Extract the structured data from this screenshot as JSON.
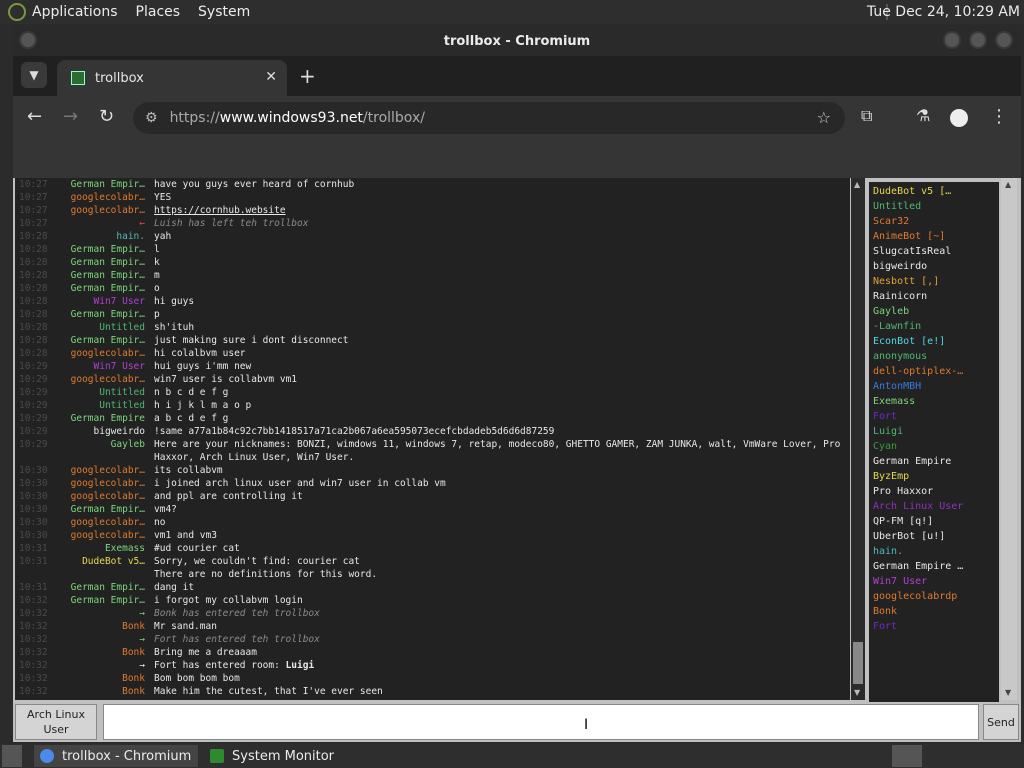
{
  "panel": {
    "menus": [
      "Applications",
      "Places",
      "System"
    ],
    "clock": "Tue Dec 24, 10:29 AM"
  },
  "window": {
    "title": "trollbox - Chromium"
  },
  "browser": {
    "tab_title": "trollbox",
    "tab_close": "✕",
    "new_tab": "+",
    "url_prefix": "https://",
    "url_host": "www.windows93.net",
    "url_path": "/trollbox/"
  },
  "chat": {
    "messages": [
      {
        "time": "10:27",
        "nick": "German Empir…",
        "nick_color": "#7cd67c",
        "text": "have you guys ever heard of cornhub",
        "type": "msg"
      },
      {
        "time": "10:27",
        "nick": "googlecolabr…",
        "nick_color": "#e07a2e",
        "text": "YES",
        "type": "msg"
      },
      {
        "time": "10:27",
        "nick": "googlecolabr…",
        "nick_color": "#e07a2e",
        "text": "https://cornhub.website",
        "type": "link"
      },
      {
        "time": "10:27",
        "nick": "←",
        "nick_color": "#e05050",
        "text": "Luish has left teh trollbox",
        "type": "sys"
      },
      {
        "time": "10:28",
        "nick": "hain.",
        "nick_color": "#4fb8b8",
        "text": "yah",
        "type": "msg"
      },
      {
        "time": "10:28",
        "nick": "German Empir…",
        "nick_color": "#7cd67c",
        "text": "l",
        "type": "msg"
      },
      {
        "time": "10:28",
        "nick": "German Empir…",
        "nick_color": "#7cd67c",
        "text": "k",
        "type": "msg"
      },
      {
        "time": "10:28",
        "nick": "German Empir…",
        "nick_color": "#7cd67c",
        "text": "m",
        "type": "msg"
      },
      {
        "time": "10:28",
        "nick": "German Empir…",
        "nick_color": "#7cd67c",
        "text": "o",
        "type": "msg"
      },
      {
        "time": "10:28",
        "nick": "Win7 User",
        "nick_color": "#b040d0",
        "text": "hi guys",
        "type": "msg"
      },
      {
        "time": "10:28",
        "nick": "German Empir…",
        "nick_color": "#7cd67c",
        "text": "p",
        "type": "msg"
      },
      {
        "time": "10:28",
        "nick": "Untitled",
        "nick_color": "#4fb870",
        "text": "sh'ituh",
        "type": "msg"
      },
      {
        "time": "10:28",
        "nick": "German Empir…",
        "nick_color": "#7cd67c",
        "text": "just making sure i dont disconnect",
        "type": "msg"
      },
      {
        "time": "10:28",
        "nick": "googlecolabr…",
        "nick_color": "#e07a2e",
        "text": "hi colalbvm user",
        "type": "msg"
      },
      {
        "time": "10:29",
        "nick": "Win7 User",
        "nick_color": "#b040d0",
        "text": "hui guys i'mm new",
        "type": "msg"
      },
      {
        "time": "10:29",
        "nick": "googlecolabr…",
        "nick_color": "#e07a2e",
        "text": "win7 user is collabvm vm1",
        "type": "msg"
      },
      {
        "time": "10:29",
        "nick": "Untitled",
        "nick_color": "#4fb870",
        "text": "n b c d e f g",
        "type": "msg"
      },
      {
        "time": "10:29",
        "nick": "Untitled",
        "nick_color": "#4fb870",
        "text": "h i j k l m a o p",
        "type": "msg"
      },
      {
        "time": "10:29",
        "nick": "German Empire",
        "nick_color": "#7cd67c",
        "text": "a b c d e f g",
        "type": "msg"
      },
      {
        "time": "10:29",
        "nick": "bigweirdo",
        "nick_color": "#e8e8e8",
        "text": "!same a77a1b84c92c7bb1418517a71ca2b067a6ea595073ecefcbdadeb5d6d6d87259",
        "type": "msg"
      },
      {
        "time": "10:29",
        "nick": "Gayleb",
        "nick_color": "#7cd67c",
        "text": "Here are your nicknames: BONZI, wimdows 11, windows 7, retap, modeco80, GHETTO GAMER, ZAM JUNKA, walt, VmWare Lover, Pro Haxxor, Arch Linux User, Win7 User.",
        "type": "msg"
      },
      {
        "time": "10:30",
        "nick": "googlecolabr…",
        "nick_color": "#e07a2e",
        "text": "its collabvm",
        "type": "msg"
      },
      {
        "time": "10:30",
        "nick": "googlecolabr…",
        "nick_color": "#e07a2e",
        "text": "i joined arch linux user and win7 user in collab vm",
        "type": "msg"
      },
      {
        "time": "10:30",
        "nick": "googlecolabr…",
        "nick_color": "#e07a2e",
        "text": "and ppl are controlling it",
        "type": "msg"
      },
      {
        "time": "10:30",
        "nick": "German Empir…",
        "nick_color": "#7cd67c",
        "text": "vm4?",
        "type": "msg"
      },
      {
        "time": "10:30",
        "nick": "googlecolabr…",
        "nick_color": "#e07a2e",
        "text": "no",
        "type": "msg"
      },
      {
        "time": "10:30",
        "nick": "googlecolabr…",
        "nick_color": "#e07a2e",
        "text": "vm1 and vm3",
        "type": "msg"
      },
      {
        "time": "10:31",
        "nick": "Exemass",
        "nick_color": "#7cd67c",
        "text": "#ud courier cat",
        "type": "msg"
      },
      {
        "time": "10:31",
        "nick": "DudeBot v5…",
        "nick_color": "#e8d84a",
        "text": "Sorry, we couldn't find: courier cat\nThere are no definitions for this word.",
        "type": "msg"
      },
      {
        "time": "10:31",
        "nick": "German Empir…",
        "nick_color": "#7cd67c",
        "text": "dang it",
        "type": "msg"
      },
      {
        "time": "10:32",
        "nick": "German Empir…",
        "nick_color": "#7cd67c",
        "text": "i forgot my collabvm login",
        "type": "msg"
      },
      {
        "time": "10:32",
        "nick": "→",
        "nick_color": "#7cd67c",
        "text": "Bonk has entered teh trollbox",
        "type": "sys"
      },
      {
        "time": "10:32",
        "nick": "Bonk",
        "nick_color": "#e07a2e",
        "text": "Mr sand.man",
        "type": "msg"
      },
      {
        "time": "10:32",
        "nick": "→",
        "nick_color": "#7cd67c",
        "text": "Fort has entered teh trollbox",
        "type": "sys"
      },
      {
        "time": "10:32",
        "nick": "Bonk",
        "nick_color": "#e07a2e",
        "text": "Bring me a dreaaam",
        "type": "msg"
      },
      {
        "time": "10:32",
        "nick": "→",
        "nick_color": "#e8e8e8",
        "text": "Fort has entered room: Luigi",
        "type": "room"
      },
      {
        "time": "10:32",
        "nick": "Bonk",
        "nick_color": "#e07a2e",
        "text": "Bom bom bom bom",
        "type": "msg"
      },
      {
        "time": "10:32",
        "nick": "Bonk",
        "nick_color": "#e07a2e",
        "text": "Make him the cutest, that I've ever seen",
        "type": "msg"
      }
    ]
  },
  "users": [
    {
      "name": "DudeBot v5 […",
      "color": "#e8d84a"
    },
    {
      "name": "Untitled",
      "color": "#4fb870"
    },
    {
      "name": "Scar32",
      "color": "#e07a2e"
    },
    {
      "name": "AnimeBot [~]",
      "color": "#e07a2e"
    },
    {
      "name": "SlugcatIsReal",
      "color": "#e8e8e8"
    },
    {
      "name": "bigweirdo",
      "color": "#e8e8e8"
    },
    {
      "name": "Nesbott [,]",
      "color": "#e8a030"
    },
    {
      "name": "Rainicorn",
      "color": "#e8e8e8"
    },
    {
      "name": "Gayleb",
      "color": "#7cd67c"
    },
    {
      "name": "-Lawnfin",
      "color": "#4fb870"
    },
    {
      "name": "EconBot [e!]",
      "color": "#4fd8e8"
    },
    {
      "name": "anonymous",
      "color": "#4fb870"
    },
    {
      "name": "dell-optiplex-…",
      "color": "#e07a2e"
    },
    {
      "name": "AntonMBH",
      "color": "#3a7ae0"
    },
    {
      "name": "Exemass",
      "color": "#7cd67c"
    },
    {
      "name": "Fort",
      "color": "#6a2ad0"
    },
    {
      "name": "Luigi",
      "color": "#4fb870"
    },
    {
      "name": "Cyan",
      "color": "#3a9a3a"
    },
    {
      "name": "German Empire",
      "color": "#e8e8e8"
    },
    {
      "name": "ByzEmp",
      "color": "#e8d84a"
    },
    {
      "name": "Pro Haxxor",
      "color": "#e8e8e8"
    },
    {
      "name": "Arch Linux User",
      "color": "#9030c0"
    },
    {
      "name": "QP-FM [q!]",
      "color": "#e8e8e8"
    },
    {
      "name": "UberBot [u!]",
      "color": "#e8e8e8"
    },
    {
      "name": "hain.",
      "color": "#4fb8b8"
    },
    {
      "name": "German Empire …",
      "color": "#e8e8e8"
    },
    {
      "name": "Win7 User",
      "color": "#b040d0"
    },
    {
      "name": "googlecolabrdp",
      "color": "#e07a2e"
    },
    {
      "name": "Bonk",
      "color": "#e07a2e"
    },
    {
      "name": "Fort",
      "color": "#6a2ad0"
    }
  ],
  "input": {
    "nick_label": "Arch Linux User",
    "send_label": "Send",
    "value": ""
  },
  "taskbar": {
    "items": [
      "trollbox - Chromium",
      "System Monitor"
    ]
  }
}
